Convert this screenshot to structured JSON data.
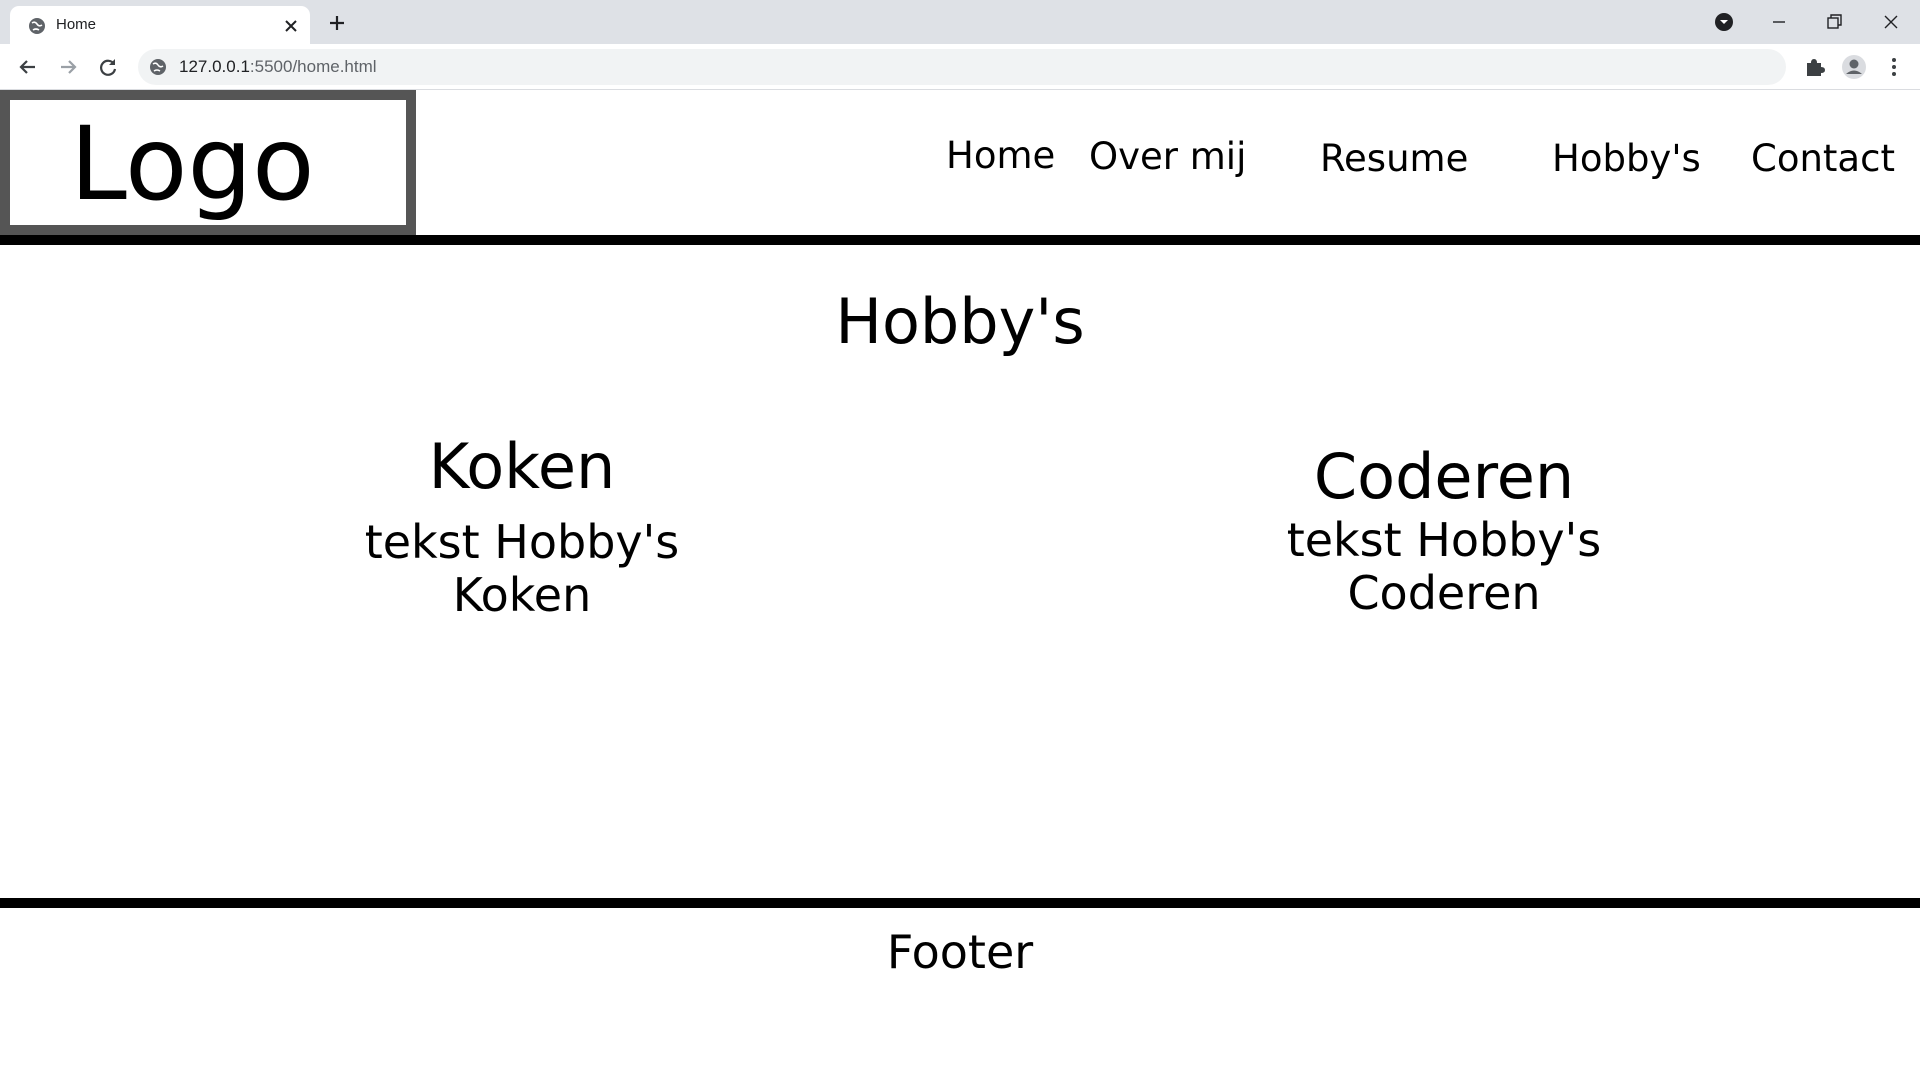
{
  "browser": {
    "tab_title": "Home",
    "url_host": "127.0.0.1",
    "url_rest": ":5500/home.html"
  },
  "site": {
    "logo": "Logo",
    "nav": [
      "Home",
      "Over mij",
      "Resume",
      "Hobby's",
      "Contact"
    ],
    "heading": "Hobby's",
    "hobbies": [
      {
        "title": "Koken",
        "line1": "tekst Hobby's",
        "line2": "Koken"
      },
      {
        "title": "Coderen",
        "line1": "tekst Hobby's",
        "line2": "Coderen"
      }
    ],
    "footer": "Footer"
  }
}
